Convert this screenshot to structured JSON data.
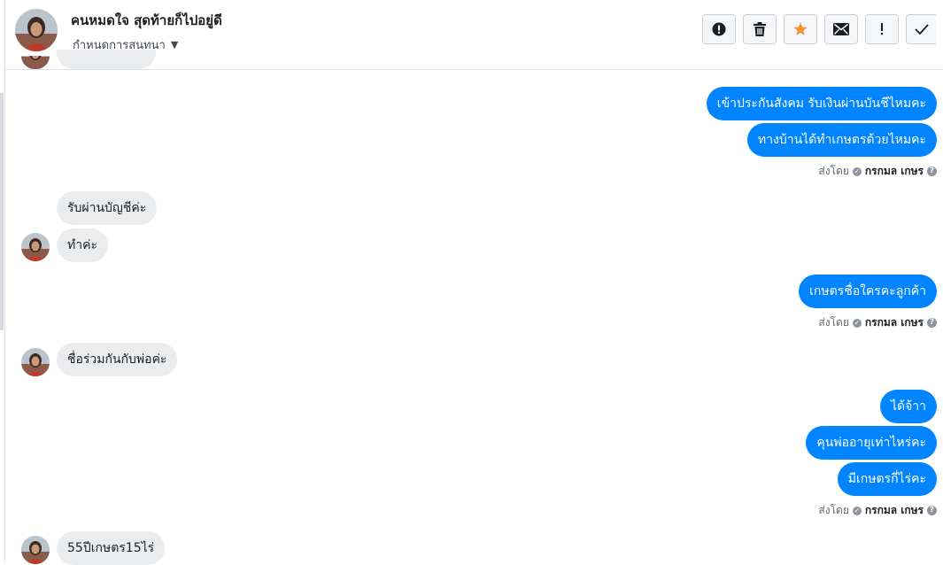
{
  "header": {
    "contact_name": "คนหมดใจ สุดท้ายก็ไปอยู่ดี",
    "conversation_settings": "กำหนดการสนทนา"
  },
  "actions": [
    {
      "icon": "exclamation-circle-icon"
    },
    {
      "icon": "trash-icon"
    },
    {
      "icon": "star-icon",
      "color": "#f7923b"
    },
    {
      "icon": "envelope-icon"
    },
    {
      "icon": "exclamation-icon"
    },
    {
      "icon": "checkmark-icon"
    }
  ],
  "messages": {
    "out1": "เข้าประกันสังคม รับเงินผ่านบันชีไหมคะ",
    "out2": "ทางบ้านได้ทำเกษตรด้วยไหมคะ",
    "in1": "รับผ่านบัญชีค่ะ",
    "in2": "ทำค่ะ",
    "out3": "เกษตรชื่อใครคะลูกค้า",
    "in3": "ชื่อร่วมกันกับพ่อค่ะ",
    "out4": "ได้จ้าา",
    "out5": "คุนพ่ออายุเท่าไหร่คะ",
    "out6": "มีเกษตรกี่ไร่คะ",
    "in4": "55ปีเกษตร15ไร่"
  },
  "sent_by": {
    "label": "ส่งโดย",
    "name": "กรกมล เกษร"
  },
  "colors": {
    "outgoing_bubble": "#0084ff",
    "incoming_bubble": "#ebecee"
  }
}
